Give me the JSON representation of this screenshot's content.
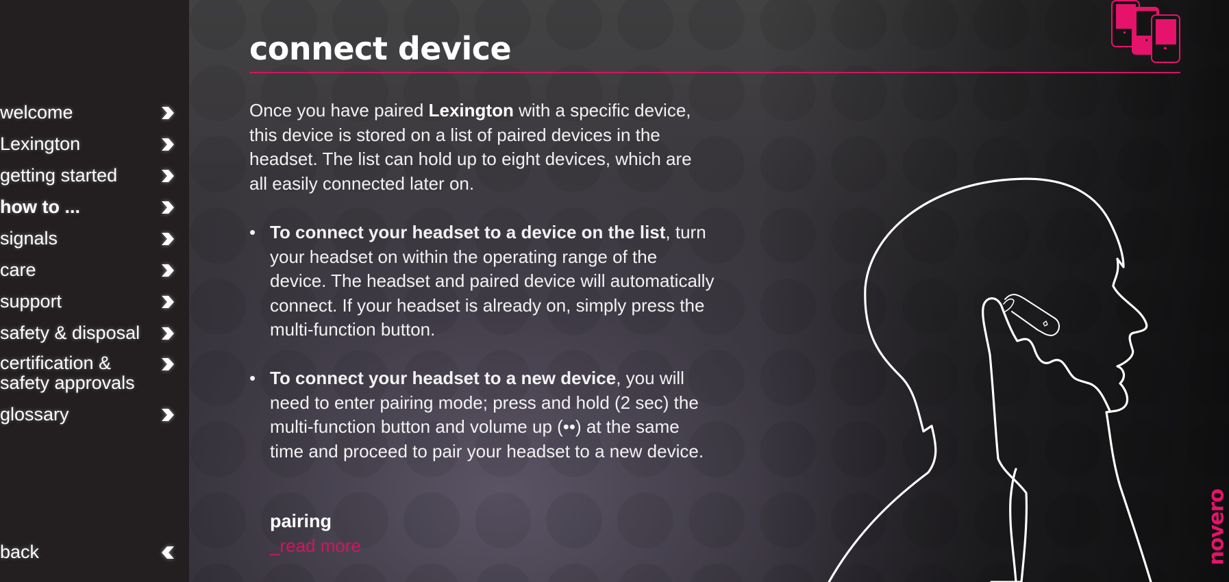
{
  "nav": {
    "items": [
      {
        "label": "welcome",
        "active": false
      },
      {
        "label": "Lexington",
        "active": false
      },
      {
        "label": "getting started",
        "active": false
      },
      {
        "label": "how to ...",
        "active": true
      },
      {
        "label": "signals",
        "active": false
      },
      {
        "label": "care",
        "active": false
      },
      {
        "label": "support",
        "active": false
      },
      {
        "label": "safety & disposal",
        "active": false
      },
      {
        "label": "certification &\nsafety approvals",
        "line1": "certification &",
        "line2": "safety approvals",
        "active": false
      },
      {
        "label": "glossary",
        "active": false
      }
    ],
    "back_label": "back",
    "item_icon": "chevron-right-icon",
    "back_icon": "chevron-left-icon"
  },
  "page": {
    "title": "connect device",
    "intro": {
      "before": "Once you have paired ",
      "bold": "Lexington",
      "after": " with a specific device, this device is stored on a list of paired devices in the headset. The list can hold up to eight devices, which are all easily connected later on."
    },
    "bullets": [
      {
        "bold": "To connect your headset to a device on the list",
        "text": ", turn your headset on within the operating range of the device. The headset and paired device will automatically connect. If your headset is already on, simply press the multi-function button."
      },
      {
        "bold": "To connect your headset to a new device",
        "text": ", you will need to enter pairing mode; press and hold (2 sec) the multi-function button and volume up (••) at the same time and proceed to pair your headset to a new device."
      }
    ],
    "bullet_glyph": "•",
    "related": {
      "heading": "pairing",
      "link_label": "_read more"
    }
  },
  "brand": {
    "logo_text": "novero",
    "accent_color": "#d6135f",
    "sidebar_color": "#231f20"
  },
  "icons": {
    "header_icon": "devices-icon",
    "illustration": "head-with-headset-illustration"
  }
}
